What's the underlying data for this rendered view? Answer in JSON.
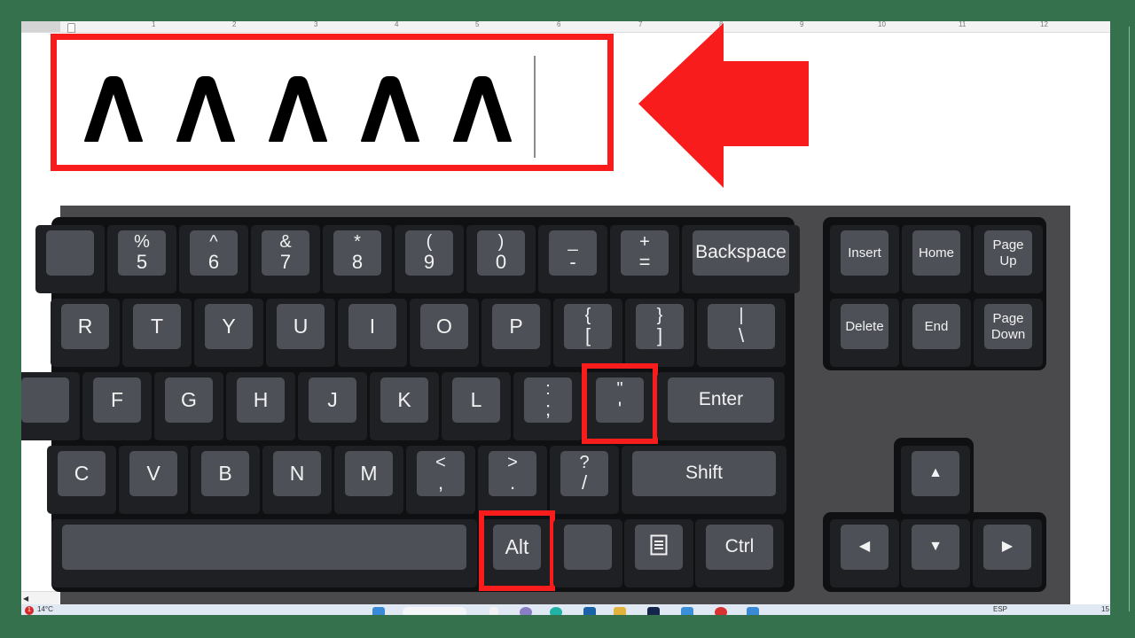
{
  "colors": {
    "frame": "#35714d",
    "highlight": "#f81c1c",
    "key_cap": "#4d5057",
    "key_cell": "#1e2023",
    "keyboard_block": "#0f1011",
    "keyboard_bg": "#4a4a4c",
    "key_text": "#f2f2f2"
  },
  "ruler": {
    "numbers": [
      "1",
      "2",
      "3",
      "4",
      "5",
      "6",
      "7",
      "8",
      "9",
      "10",
      "11",
      "12"
    ]
  },
  "document": {
    "typed_text": [
      "Λ",
      "Λ",
      "Λ",
      "Λ",
      "Λ"
    ],
    "cursor_visible": true
  },
  "keyboard": {
    "number_row": [
      {
        "top": "",
        "bottom": ""
      },
      {
        "top": "%",
        "bottom": "5"
      },
      {
        "top": "^",
        "bottom": "6"
      },
      {
        "top": "&",
        "bottom": "7"
      },
      {
        "top": "*",
        "bottom": "8"
      },
      {
        "top": "(",
        "bottom": "9"
      },
      {
        "top": ")",
        "bottom": "0"
      },
      {
        "top": "_",
        "bottom": "-"
      },
      {
        "top": "+",
        "bottom": "="
      },
      {
        "label": "Backspace"
      }
    ],
    "top_row": [
      {
        "label": "R"
      },
      {
        "label": "T"
      },
      {
        "label": "Y"
      },
      {
        "label": "U"
      },
      {
        "label": "I"
      },
      {
        "label": "O"
      },
      {
        "label": "P"
      },
      {
        "top": "{",
        "bottom": "["
      },
      {
        "top": "}",
        "bottom": "]"
      },
      {
        "top": "|",
        "bottom": "\\"
      }
    ],
    "home_row": [
      {
        "label": ""
      },
      {
        "label": "F"
      },
      {
        "label": "G"
      },
      {
        "label": "H"
      },
      {
        "label": "J"
      },
      {
        "label": "K"
      },
      {
        "label": "L"
      },
      {
        "top": ":",
        "bottom": ";"
      },
      {
        "top": "\"",
        "bottom": "'",
        "highlighted": true
      },
      {
        "label": "Enter"
      }
    ],
    "bottom_row": [
      {
        "label": "C"
      },
      {
        "label": "V"
      },
      {
        "label": "B"
      },
      {
        "label": "N"
      },
      {
        "label": "M"
      },
      {
        "top": "<",
        "bottom": ","
      },
      {
        "top": ">",
        "bottom": "."
      },
      {
        "top": "?",
        "bottom": "/"
      },
      {
        "label": "Shift"
      }
    ],
    "space_row": [
      {
        "label": "",
        "name": "space"
      },
      {
        "label": "Alt",
        "highlighted": true
      },
      {
        "label": "",
        "name": "fn"
      },
      {
        "label": "",
        "name": "menu",
        "icon": "menu-icon"
      },
      {
        "label": "Ctrl"
      }
    ],
    "nav_cluster": [
      {
        "label": "Insert"
      },
      {
        "label": "Home"
      },
      {
        "label": "Page\nUp",
        "line1": "Page",
        "line2": "Up"
      },
      {
        "label": "Delete"
      },
      {
        "label": "End"
      },
      {
        "label": "Page\nDown",
        "line1": "Page",
        "line2": "Down"
      }
    ],
    "arrow_cluster": {
      "up": "▲",
      "left": "◀",
      "down": "▼",
      "right": "▶"
    }
  },
  "taskbar": {
    "weather_badge": "1",
    "weather_temp": "14°C",
    "language": "ESP",
    "clock": "15"
  }
}
